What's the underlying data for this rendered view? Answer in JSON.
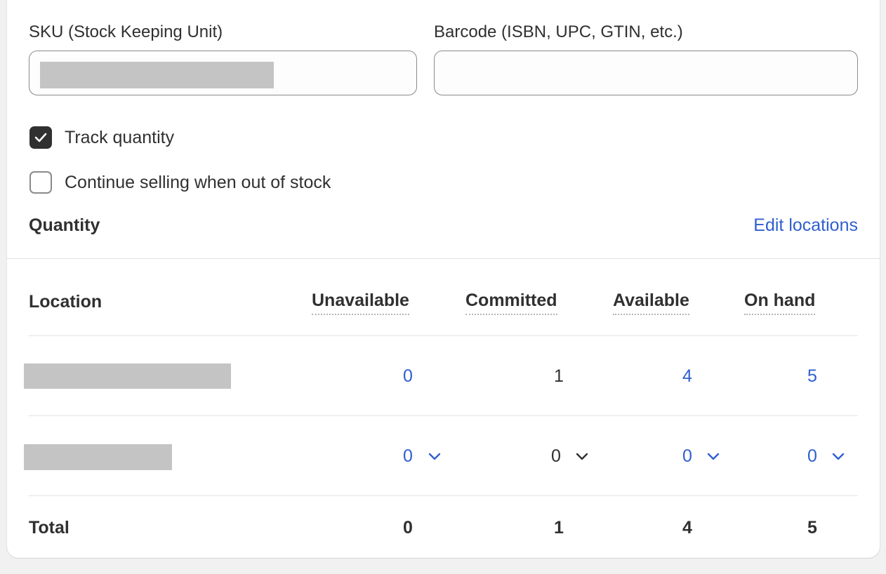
{
  "sku": {
    "label": "SKU (Stock Keeping Unit)"
  },
  "barcode": {
    "label": "Barcode (ISBN, UPC, GTIN, etc.)",
    "value": ""
  },
  "options": {
    "track_quantity": {
      "label": "Track quantity",
      "checked": true
    },
    "continue_selling": {
      "label": "Continue selling when out of stock",
      "checked": false
    }
  },
  "quantity": {
    "title": "Quantity",
    "edit_link": "Edit locations"
  },
  "table": {
    "headers": {
      "location": "Location",
      "unavailable": "Unavailable",
      "committed": "Committed",
      "available": "Available",
      "on_hand": "On hand"
    },
    "rows": [
      {
        "unavailable": "0",
        "committed": "1",
        "available": "4",
        "on_hand": "5"
      },
      {
        "unavailable": "0",
        "committed": "0",
        "available": "0",
        "on_hand": "0"
      }
    ],
    "total": {
      "label": "Total",
      "unavailable": "0",
      "committed": "1",
      "available": "4",
      "on_hand": "5"
    }
  },
  "colors": {
    "link": "#2f5fd0",
    "text": "#303030",
    "checkbox_checked": "#303030"
  },
  "icons": {
    "check": "checkmark-icon",
    "chevron": "chevron-down-icon"
  }
}
